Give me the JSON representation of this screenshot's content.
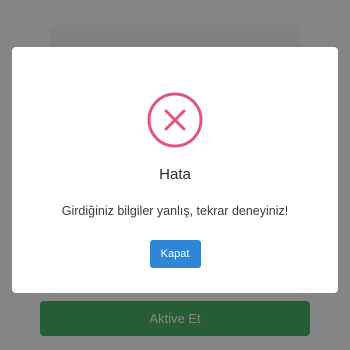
{
  "background": {
    "action_button_label": "Aktive Et"
  },
  "modal": {
    "icon": "x-circle-icon",
    "icon_color": "#e0567a",
    "title": "Hata",
    "message": "Girdiğiniz bilgiler yanlış, tekrar deneyiniz!",
    "close_label": "Kapat",
    "close_color": "#2f86d6"
  }
}
